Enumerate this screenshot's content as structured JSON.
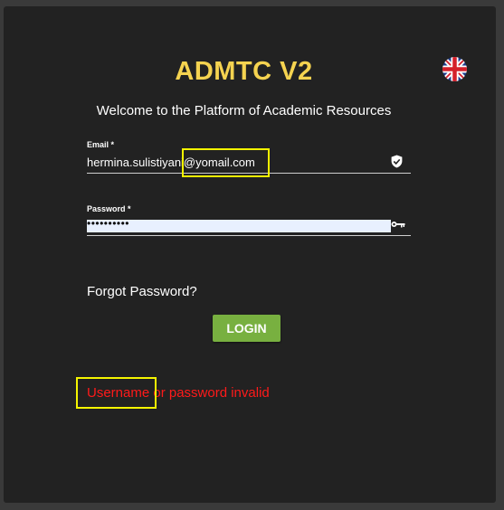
{
  "app": {
    "title": "ADMTC V2",
    "subtitle": "Welcome to the Platform of Academic Resources",
    "language_icon": "uk-flag-icon"
  },
  "form": {
    "email": {
      "label": "Email *",
      "value": "hermina.sulistiyani@yomail.com",
      "icon": "shield-check-icon"
    },
    "password": {
      "label": "Password *",
      "masked_value": "••••••••••",
      "icon": "key-icon"
    },
    "forgot_label": "Forgot Password?",
    "login_label": "LOGIN"
  },
  "error": {
    "message": "Username or password invalid"
  },
  "colors": {
    "title": "#f5d350",
    "login_button": "#78b040",
    "error": "#ff1a1a",
    "highlight": "#f5f500"
  }
}
